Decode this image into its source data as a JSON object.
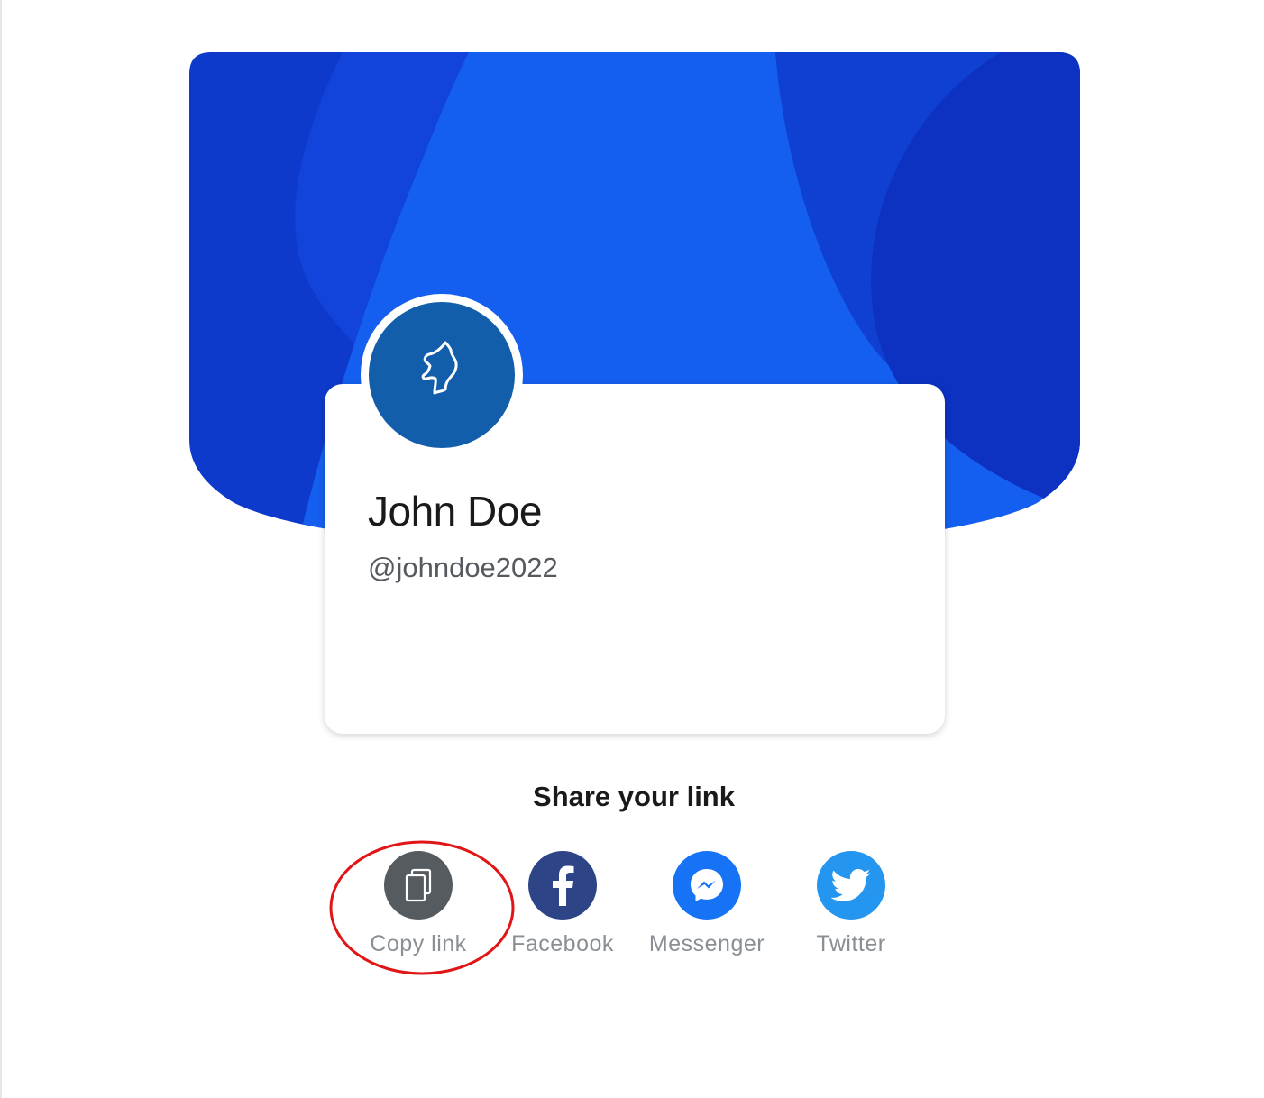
{
  "profile": {
    "name": "John Doe",
    "handle": "@johndoe2022",
    "avatar_icon": "face-profile-icon"
  },
  "share": {
    "title": "Share your link",
    "options": [
      {
        "label": "Copy link",
        "icon": "copy-icon",
        "color": "#555b5f"
      },
      {
        "label": "Facebook",
        "icon": "facebook-icon",
        "color": "#2d4486"
      },
      {
        "label": "Messenger",
        "icon": "messenger-icon",
        "color": "#1773f5"
      },
      {
        "label": "Twitter",
        "icon": "twitter-icon",
        "color": "#2596f0"
      }
    ],
    "highlighted_option": "Copy link"
  },
  "colors": {
    "banner_base": "#0e3acb",
    "banner_light": "#155ff0",
    "banner_dark": "#0d32c2",
    "avatar_bg": "#135eab",
    "highlight_ring": "#e01515"
  }
}
